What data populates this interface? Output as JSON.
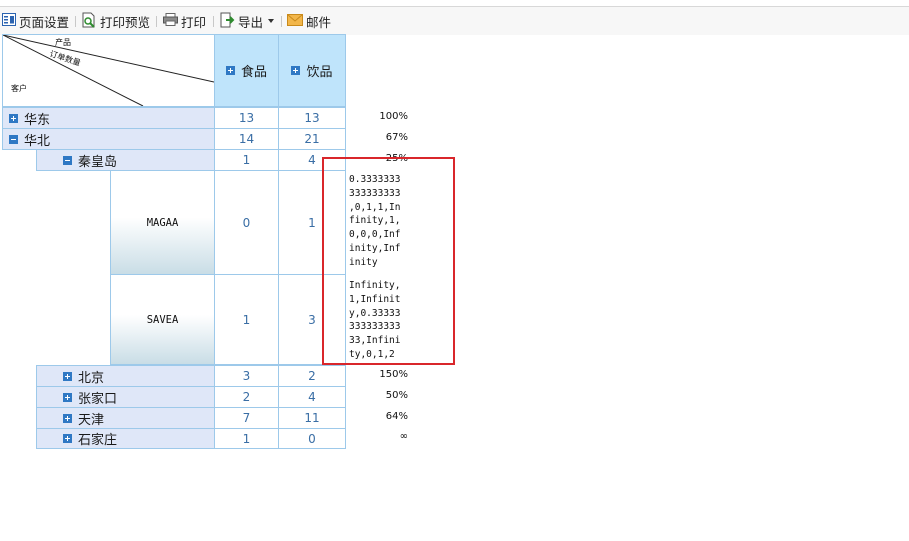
{
  "toolbar": {
    "page_setup": "页面设置",
    "print_preview": "打印预览",
    "print": "打印",
    "export": "导出",
    "mail": "邮件"
  },
  "corner": {
    "product": "产品",
    "order_qty": "订单数量",
    "customer": "客户"
  },
  "columns": [
    "食品",
    "饮品"
  ],
  "rows": {
    "east": {
      "label": "华东",
      "v1": "13",
      "v2": "13",
      "pct": "100%"
    },
    "north": {
      "label": "华北",
      "v1": "14",
      "v2": "21",
      "pct": "67%"
    },
    "qinhuangdao": {
      "label": "秦皇岛",
      "v1": "1",
      "v2": "4",
      "pct": "25%"
    },
    "magaa": {
      "label": "MAGAA",
      "v1": "0",
      "v2": "1",
      "text": "0.3333333\n333333333\n,0,1,1,In\nfinity,1,\n0,0,0,Inf\ninity,Inf\ninity"
    },
    "savea": {
      "label": "SAVEA",
      "v1": "1",
      "v2": "3",
      "text": "Infinity,\n1,Infinit\ny,0.33333\n333333333\n33,Infini\nty,0,1,2"
    },
    "beijing": {
      "label": "北京",
      "v1": "3",
      "v2": "2",
      "pct": "150%"
    },
    "zhangjiakou": {
      "label": "张家口",
      "v1": "2",
      "v2": "4",
      "pct": "50%"
    },
    "tianjin": {
      "label": "天津",
      "v1": "7",
      "v2": "11",
      "pct": "64%"
    },
    "shijiazhuang": {
      "label": "石家庄",
      "v1": "1",
      "v2": "0",
      "pct": "∞"
    }
  },
  "colors": {
    "highlight_box": "#d9262b",
    "header_blue": "#bfe4fb",
    "row_blue": "#dfe7f8"
  }
}
